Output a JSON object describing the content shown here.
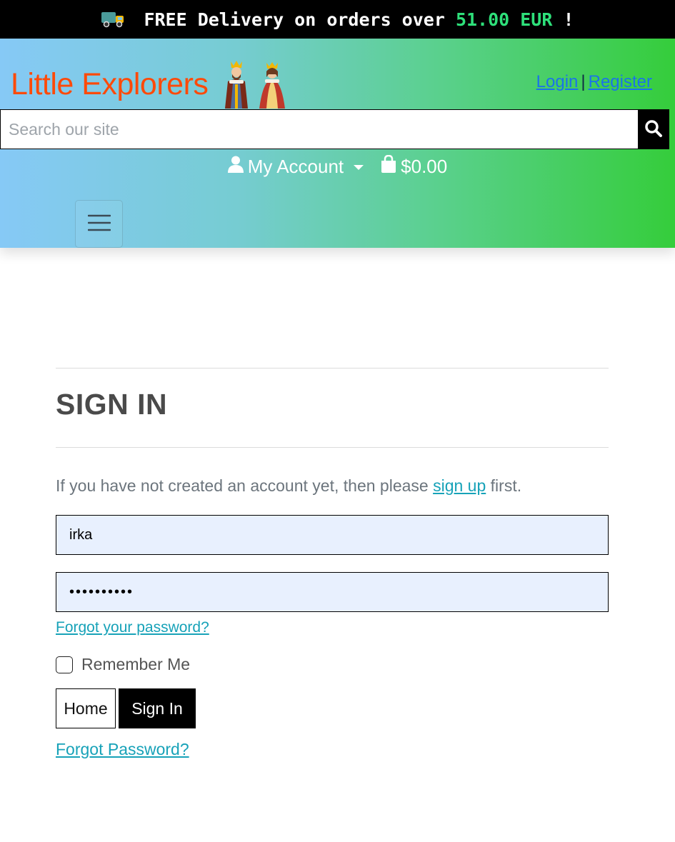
{
  "banner": {
    "truck_icon": "delivery-truck-icon",
    "text_before": "FREE Delivery on orders over ",
    "amount": "51.00 EUR",
    "text_after": " !"
  },
  "header": {
    "brand": "Little Explorers",
    "brand_image": "king-and-queen-logo",
    "login": "Login",
    "separator": "|",
    "register": "Register",
    "search_placeholder": "Search our site",
    "search_icon": "search-icon",
    "account_label": "My Account",
    "account_icon": "user-icon",
    "cart_total": "$0.00",
    "cart_icon": "shopping-bag-icon",
    "menu_icon": "hamburger-menu-icon"
  },
  "signin": {
    "title": "SIGN IN",
    "intro_before": "If you have not created an account yet, then please ",
    "intro_link": "sign up",
    "intro_after": " first.",
    "username_value": "irka",
    "password_value": "••••••••••",
    "forgot_password_link": "Forgot your password?",
    "remember_label": "Remember Me",
    "home_button": "Home",
    "signin_button": "Sign In",
    "forgot_password_bottom": "Forgot Password?"
  },
  "colors": {
    "brand": "#fe4a09",
    "link": "#17a2b8",
    "amount": "#2ee07a",
    "gradient_start": "#86c9f6",
    "gradient_end": "#35cd3b"
  }
}
